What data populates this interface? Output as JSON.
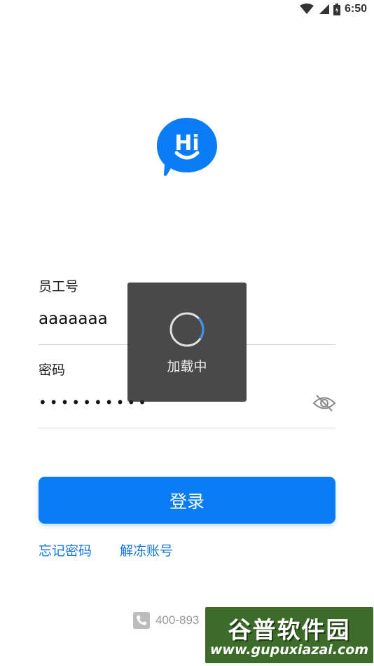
{
  "status_bar": {
    "time": "6:50",
    "icons": [
      "wifi-icon",
      "signal-icon",
      "battery-icon"
    ]
  },
  "logo": {
    "text": "Hi",
    "color": "#0a7cf6",
    "icon": "smile-chat-bubble-icon"
  },
  "form": {
    "employee_label": "员工号",
    "employee_value": "aaaaaaa",
    "password_label": "密码",
    "password_value": "••••••••••",
    "password_toggle_icon": "eye-off-icon"
  },
  "login_button": {
    "label": "登录",
    "color": "#0a7cf6"
  },
  "links": {
    "forgot_password": "忘记密码",
    "unfreeze_account": "解冻账号"
  },
  "footer": {
    "phone_icon": "phone-icon",
    "phone_number": "400-893"
  },
  "loading": {
    "text": "加载中",
    "spinner_icon": "loading-spinner-icon"
  },
  "watermark": {
    "title": "谷普软件园",
    "url": "www.gupuxiazai.com"
  }
}
